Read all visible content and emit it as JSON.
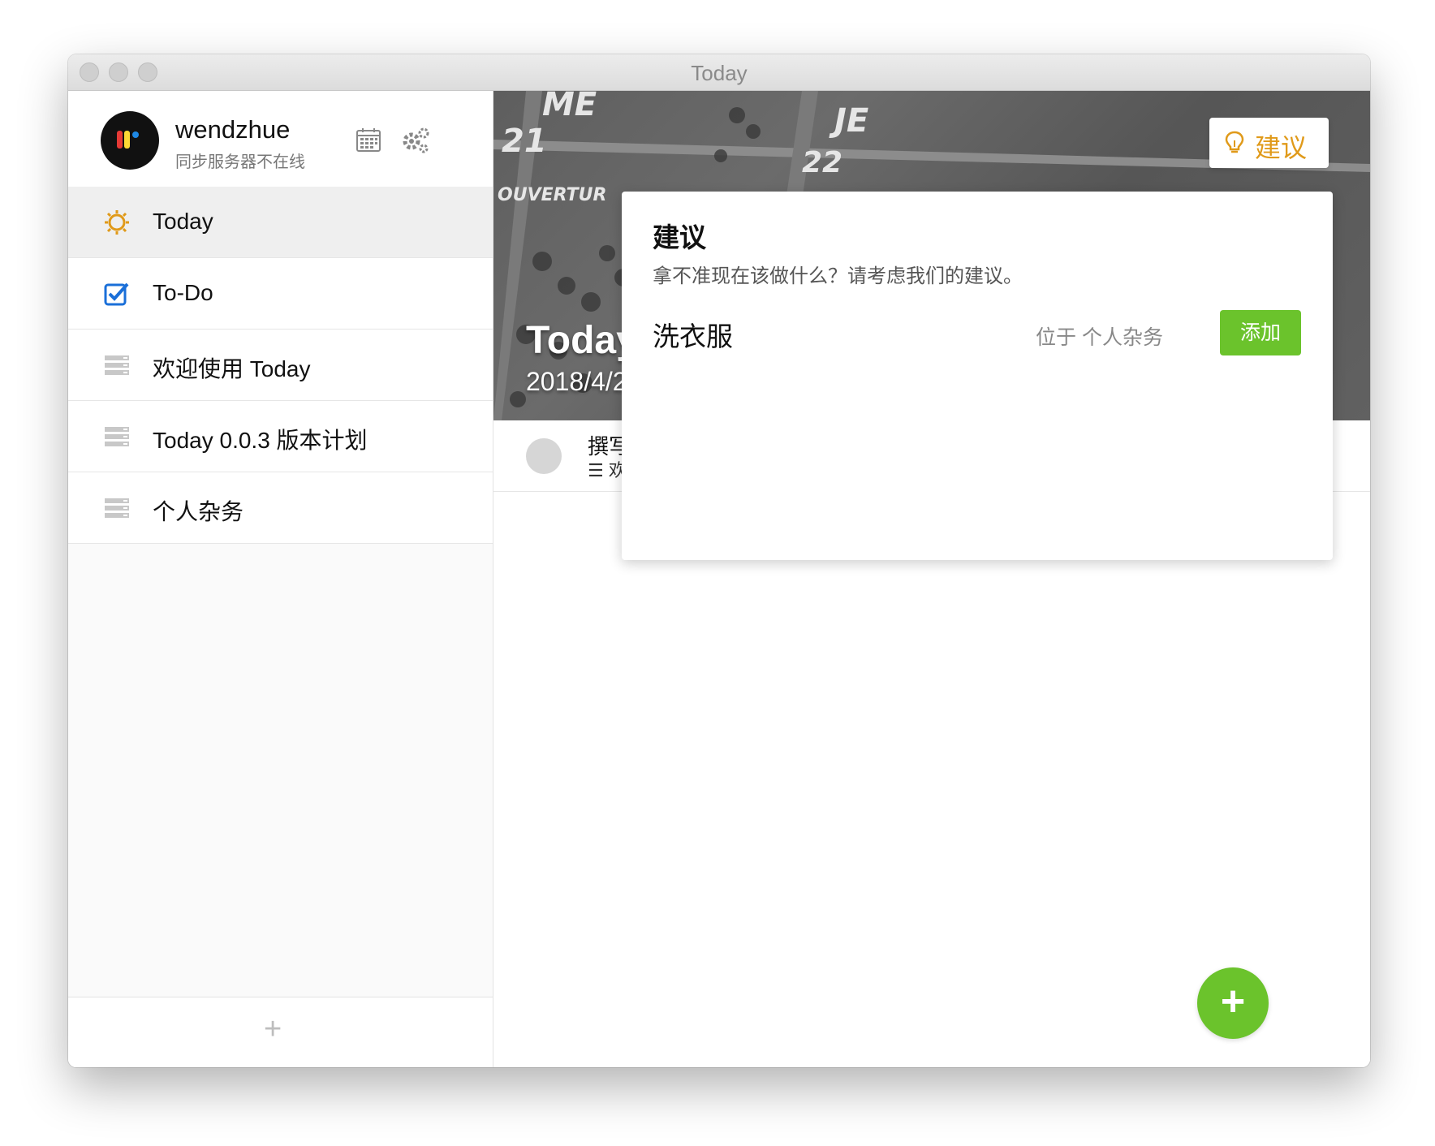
{
  "window": {
    "title": "Today"
  },
  "profile": {
    "username": "wendzhue",
    "status": "同步服务器不在线"
  },
  "nav": [
    {
      "label": "Today",
      "icon": "sun-icon"
    },
    {
      "label": "To-Do",
      "icon": "checkbox-icon"
    },
    {
      "label": "欢迎使用 Today",
      "icon": "list-icon"
    },
    {
      "label": "Today 0.0.3 版本计划",
      "icon": "list-icon"
    },
    {
      "label": "个人杂务",
      "icon": "list-icon"
    }
  ],
  "sidebar_footer": {
    "add_label": "+"
  },
  "hero": {
    "title": "Today",
    "date": "2018/4/2",
    "suggest_label": "建议"
  },
  "task": {
    "title": "撰写",
    "subtitle": "☰ 欢"
  },
  "popover": {
    "title": "建议",
    "subtitle": "拿不准现在该做什么？请考虑我们的建议。",
    "item": {
      "name": "洗衣服",
      "location": "位于 个人杂务",
      "add_label": "添加"
    }
  },
  "fab": {
    "label": "+"
  },
  "colors": {
    "accent_green": "#6bc32c",
    "suggest_orange": "#e09a1a",
    "todo_blue": "#1a6fd8"
  }
}
